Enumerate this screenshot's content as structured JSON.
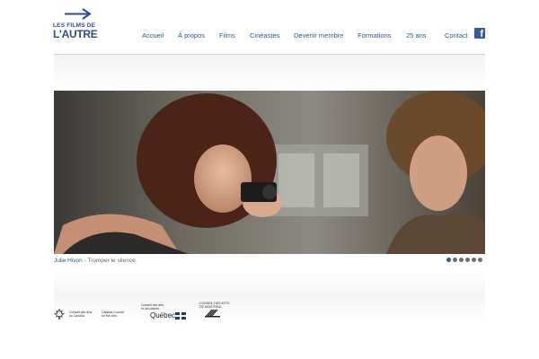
{
  "logo": {
    "line1": "LES FILMS DE",
    "line2": "L'AUTRE",
    "arrow_icon": "arrow-right-icon",
    "color": "#2b4e86"
  },
  "nav": {
    "items": [
      {
        "label": "Accueil"
      },
      {
        "label": "À propos"
      },
      {
        "label": "Films"
      },
      {
        "label": "Cinéastes"
      },
      {
        "label": "Devenir membre"
      },
      {
        "label": "Formations"
      },
      {
        "label": "25 ans"
      },
      {
        "label": "Contact"
      }
    ],
    "facebook_icon": "facebook-icon",
    "facebook_glyph": "f",
    "link_color": "#2b5a8c"
  },
  "hero": {
    "image_subject": "film still: woman with camera facing young man"
  },
  "caption": {
    "name": "Julie Hivon",
    "separator": " - ",
    "title": "Tromper le silence"
  },
  "slideshow": {
    "total": 6,
    "active_index": 0
  },
  "sponsors": {
    "conseil": {
      "fr_line1": "Conseil des Arts",
      "fr_line2": "du Canada",
      "en_line1": "Canada Council",
      "en_line2": "for the Arts"
    },
    "quebec": {
      "line1": "Conseil des arts",
      "line2": "et des lettres",
      "name": "Québec"
    },
    "montreal": {
      "line1": "CONSEIL DES ARTS",
      "line2": "DE MONTRÉAL"
    }
  }
}
